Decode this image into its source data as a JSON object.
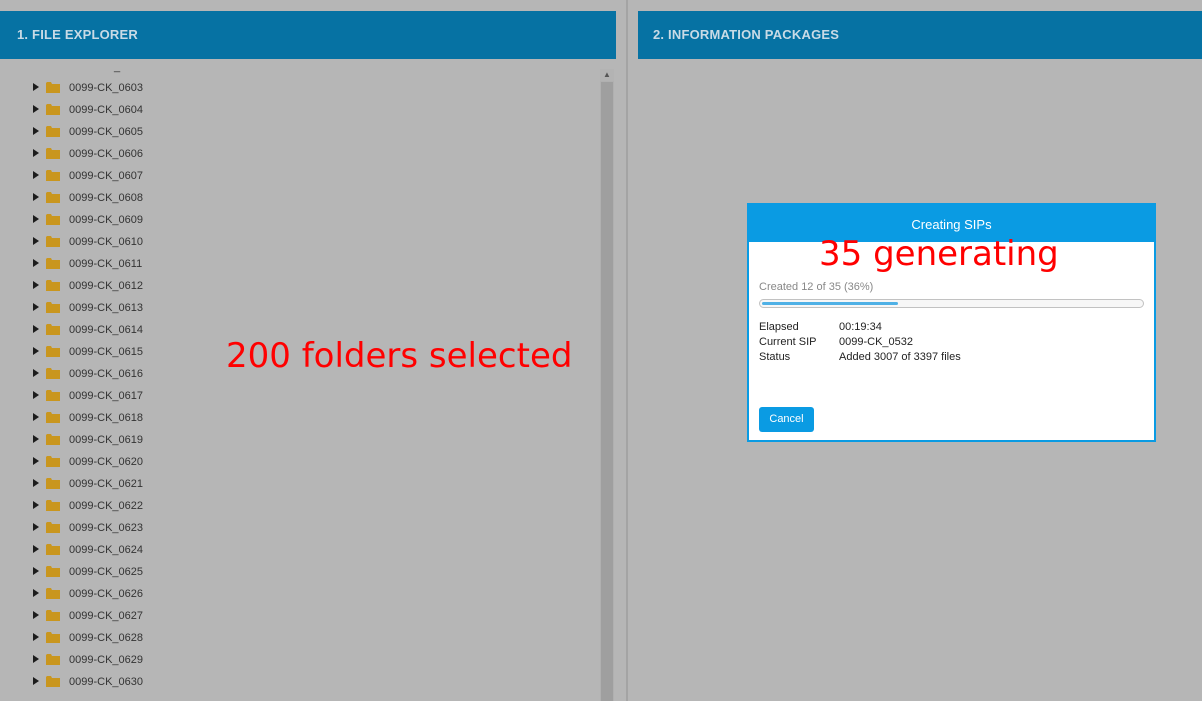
{
  "left_panel": {
    "title": "1. FILE EXPLORER",
    "tree_dash": "_",
    "folders": [
      "0099-CK_0603",
      "0099-CK_0604",
      "0099-CK_0605",
      "0099-CK_0606",
      "0099-CK_0607",
      "0099-CK_0608",
      "0099-CK_0609",
      "0099-CK_0610",
      "0099-CK_0611",
      "0099-CK_0612",
      "0099-CK_0613",
      "0099-CK_0614",
      "0099-CK_0615",
      "0099-CK_0616",
      "0099-CK_0617",
      "0099-CK_0618",
      "0099-CK_0619",
      "0099-CK_0620",
      "0099-CK_0621",
      "0099-CK_0622",
      "0099-CK_0623",
      "0099-CK_0624",
      "0099-CK_0625",
      "0099-CK_0626",
      "0099-CK_0627",
      "0099-CK_0628",
      "0099-CK_0629",
      "0099-CK_0630"
    ],
    "annotation": "200 folders selected"
  },
  "right_panel": {
    "title": "2. INFORMATION PACKAGES"
  },
  "modal": {
    "title": "Creating SIPs",
    "annotation": "35 generating",
    "progress_text": "Created 12 of 35 (36%)",
    "progress_fraction": 0.36,
    "rows": [
      {
        "label": "Elapsed",
        "value": "00:19:34"
      },
      {
        "label": "Current SIP",
        "value": "0099-CK_0532"
      },
      {
        "label": "Status",
        "value": "Added 3007 of 3397 files"
      }
    ],
    "cancel_label": "Cancel"
  },
  "icons": {
    "expand": "caret-right-icon",
    "folder": "folder-icon",
    "scroll_up": "scroll-up-arrow-icon"
  },
  "colors": {
    "header_bg": "#0672a3",
    "modal_accent": "#0a9be3",
    "folder": "#c9961e",
    "annotation": "#ff0000",
    "background": "#b6b6b6"
  }
}
